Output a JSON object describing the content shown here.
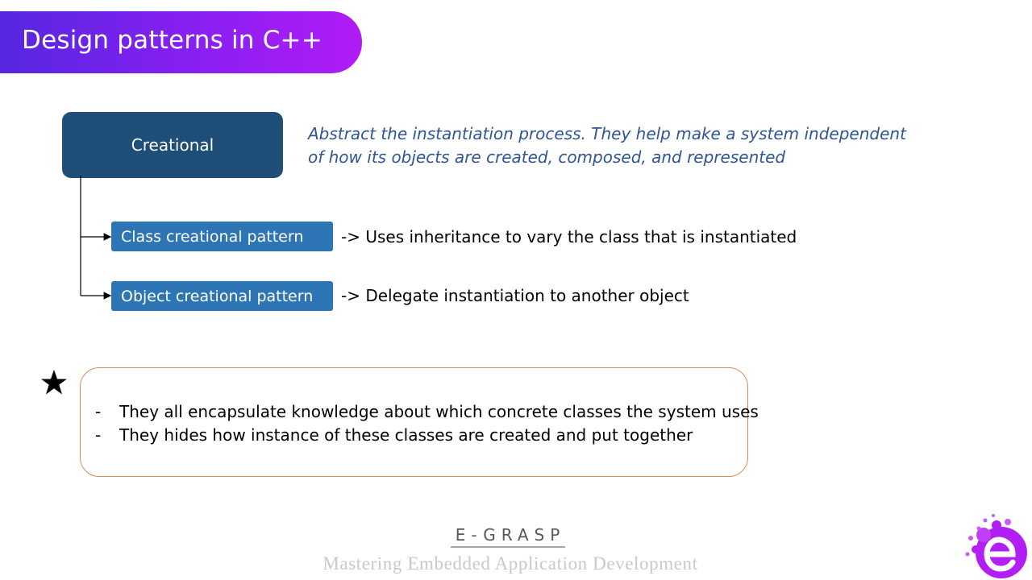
{
  "header": {
    "title": "Design patterns in C++"
  },
  "diagram": {
    "root": "Creational",
    "root_description": [
      "Abstract the instantiation process. They help make a system independent",
      "of how its objects are created, composed, and represented"
    ],
    "children": [
      {
        "label": "Class creational pattern",
        "description": "-> Uses inheritance to vary the class that is instantiated"
      },
      {
        "label": "Object creational pattern",
        "description": "-> Delegate instantiation to another object"
      }
    ]
  },
  "note": {
    "marker": "star-icon",
    "bullet": "-",
    "items": [
      "They all encapsulate knowledge about which concrete classes the system uses",
      "They hides how instance of these classes are created and put together"
    ]
  },
  "footer": {
    "brand": "E-GRASP",
    "tagline": "Mastering Embedded Application Development",
    "logo": "e-grasp-logo-icon"
  },
  "colors": {
    "title_gradient_start": "#5527e0",
    "title_gradient_end": "#b11cf6",
    "root_box": "#1f4e79",
    "child_box": "#2e75b6",
    "description_text": "#2f5597",
    "note_border": "#d98b52",
    "logo": "#b21ff4"
  }
}
